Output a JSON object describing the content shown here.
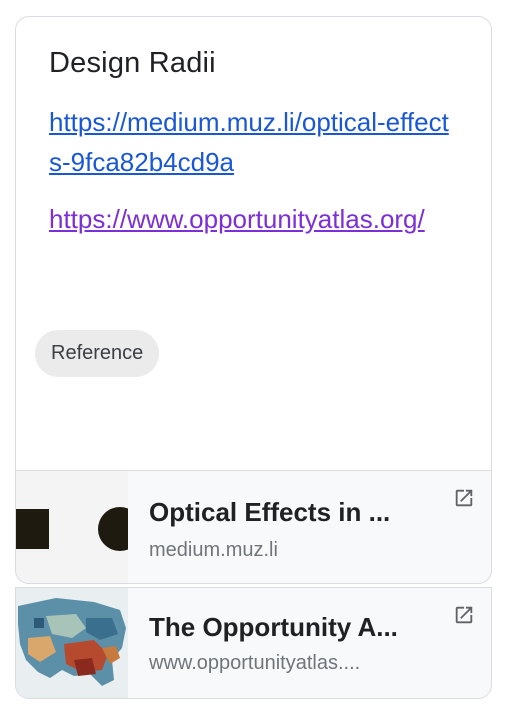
{
  "note": {
    "title": "Design Radii",
    "links": [
      "https://medium.muz.li/optical-effects-9fca82b4cd9a",
      "https://www.opportunityatlas.org/"
    ],
    "label": "Reference"
  },
  "previews": [
    {
      "title": "Optical Effects in ...",
      "domain": "medium.muz.li",
      "thumbnail": "black-square-and-circle",
      "icon": "open-in-new-icon"
    },
    {
      "title": "The Opportunity A...",
      "domain": "www.opportunityatlas....",
      "thumbnail": "us-map",
      "icon": "open-in-new-icon"
    }
  ],
  "colors": {
    "link": "#1a57d6",
    "visited_link": "#7b2fd6",
    "chip_bg": "#ebebeb"
  }
}
